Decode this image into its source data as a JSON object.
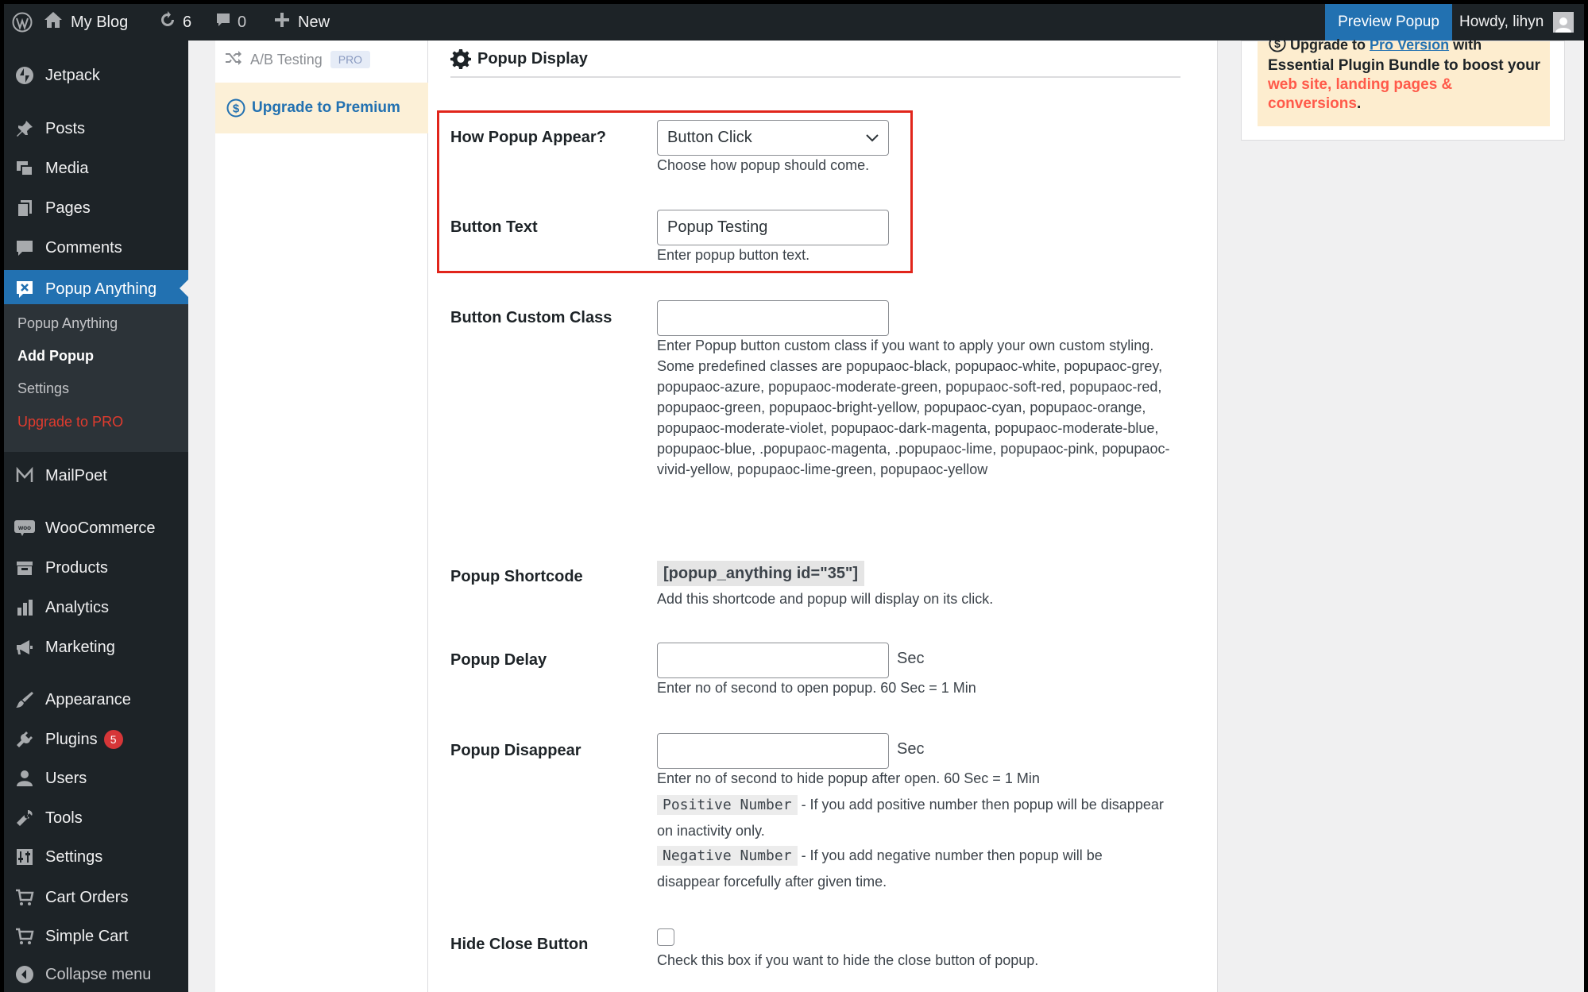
{
  "admin_bar": {
    "site_name": "My Blog",
    "updates_count": "6",
    "comments_count": "0",
    "new_label": "New",
    "preview_label": "Preview Popup",
    "howdy_label": "Howdy, lihyn"
  },
  "sidebar": {
    "items": [
      {
        "label": "Jetpack"
      },
      {
        "label": "Posts"
      },
      {
        "label": "Media"
      },
      {
        "label": "Pages"
      },
      {
        "label": "Comments"
      },
      {
        "label": "Popup Anything"
      },
      {
        "label": "MailPoet"
      },
      {
        "label": "WooCommerce"
      },
      {
        "label": "Products"
      },
      {
        "label": "Analytics"
      },
      {
        "label": "Marketing"
      },
      {
        "label": "Appearance"
      },
      {
        "label": "Plugins",
        "badge": "5"
      },
      {
        "label": "Users"
      },
      {
        "label": "Tools"
      },
      {
        "label": "Settings"
      },
      {
        "label": "Cart Orders"
      },
      {
        "label": "Simple Cart"
      }
    ],
    "submenu": [
      {
        "label": "Popup Anything"
      },
      {
        "label": "Add Popup"
      },
      {
        "label": "Settings"
      },
      {
        "label": "Upgrade to PRO"
      }
    ],
    "collapse_label": "Collapse menu"
  },
  "tabs": {
    "ab_testing": "A/B Testing",
    "pro_tag": "PRO",
    "upgrade": "Upgrade to Premium"
  },
  "main": {
    "section_title": "Popup Display",
    "fields": {
      "appear": {
        "label": "How Popup Appear?",
        "value": "Button Click",
        "desc": "Choose how popup should come."
      },
      "button_text": {
        "label": "Button Text",
        "value": "Popup Testing",
        "desc": "Enter popup button text."
      },
      "custom_class": {
        "label": "Button Custom Class",
        "value": "",
        "desc": "Enter Popup button custom class if you want to apply your own custom styling. Some predefined classes are popupaoc-black, popupaoc-white, popupaoc-grey, popupaoc-azure, popupaoc-moderate-green, popupaoc-soft-red, popupaoc-red, popupaoc-green, popupaoc-bright-yellow, popupaoc-cyan, popupaoc-orange, popupaoc-moderate-violet, popupaoc-dark-magenta, popupaoc-moderate-blue, popupaoc-blue, .popupaoc-magenta, .popupaoc-lime, popupaoc-pink, popupaoc-vivid-yellow, popupaoc-lime-green, popupaoc-yellow"
      },
      "shortcode": {
        "label": "Popup Shortcode",
        "value": "[popup_anything id=\"35\"]",
        "desc": "Add this shortcode and popup will display on its click."
      },
      "delay": {
        "label": "Popup Delay",
        "value": "",
        "unit": "Sec",
        "desc": "Enter no of second to open popup. 60 Sec = 1 Min"
      },
      "disappear": {
        "label": "Popup Disappear",
        "value": "",
        "unit": "Sec",
        "desc": "Enter no of second to hide popup after open. 60 Sec = 1 Min",
        "positive_code": "Positive Number",
        "positive_text": " - If you add positive number then popup will be disappear on inactivity only.",
        "negative_code": "Negative Number",
        "negative_text": " - If you add negative number then popup will be disappear forcefully after given time."
      },
      "hide_close": {
        "label": "Hide Close Button",
        "desc": "Check this box if you want to hide the close button of popup."
      }
    }
  },
  "promo": {
    "top_prefix": "Upgrade to",
    "top_link": "Pro Version",
    "top_suffix": "with",
    "text_plain": "Essential Plugin Bundle to boost your",
    "text_red": "web site, landing pages & conversions",
    "text_end": "."
  },
  "colors": {
    "accent": "#2271b1",
    "sidebar": "#1d2327",
    "highlight": "#e1251b",
    "badge": "#d63638"
  }
}
